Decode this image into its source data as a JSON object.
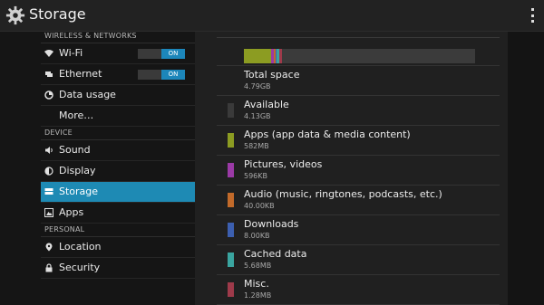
{
  "app": {
    "title": "Storage",
    "icon": "gear-icon"
  },
  "sidebar": {
    "headers": [
      "WIRELESS & NETWORKS",
      "DEVICE",
      "PERSONAL"
    ],
    "items": [
      {
        "label": "Wi-Fi",
        "icon": "wifi-icon",
        "toggle": "ON"
      },
      {
        "label": "Ethernet",
        "icon": "ethernet-icon",
        "toggle": "ON"
      },
      {
        "label": "Data usage",
        "icon": "data-usage-icon"
      },
      {
        "label": "More…"
      },
      {
        "label": "Sound",
        "icon": "sound-icon"
      },
      {
        "label": "Display",
        "icon": "display-icon"
      },
      {
        "label": "Storage",
        "icon": "storage-icon",
        "selected": true
      },
      {
        "label": "Apps",
        "icon": "apps-icon"
      },
      {
        "label": "Location",
        "icon": "location-icon"
      },
      {
        "label": "Security",
        "icon": "security-icon"
      }
    ]
  },
  "storage": {
    "total": {
      "label": "Total space",
      "size": "4.79GB"
    },
    "rows": [
      {
        "label": "Available",
        "size": "4.13GB",
        "color": "#3a3a3a"
      },
      {
        "label": "Apps (app data & media content)",
        "size": "582MB",
        "color": "#8c9c22"
      },
      {
        "label": "Pictures, videos",
        "size": "596KB",
        "color": "#9b3aa6"
      },
      {
        "label": "Audio (music, ringtones, podcasts, etc.)",
        "size": "40.00KB",
        "color": "#c26a2a"
      },
      {
        "label": "Downloads",
        "size": "8.00KB",
        "color": "#3c5fb0"
      },
      {
        "label": "Cached data",
        "size": "5.68MB",
        "color": "#3aa5a0"
      },
      {
        "label": "Misc.",
        "size": "1.28MB",
        "color": "#9e3a4a"
      }
    ],
    "bar": [
      {
        "color": "#8c9c22",
        "fraction": 0.118
      },
      {
        "color": "#9b3aa6",
        "fraction": 0.012
      },
      {
        "color": "#c26a2a",
        "fraction": 0.006
      },
      {
        "color": "#3c5fb0",
        "fraction": 0.006
      },
      {
        "color": "#3aa5a0",
        "fraction": 0.012
      },
      {
        "color": "#9e3a4a",
        "fraction": 0.01
      },
      {
        "color": "#3b3b3b",
        "fraction": 0.836
      }
    ]
  }
}
